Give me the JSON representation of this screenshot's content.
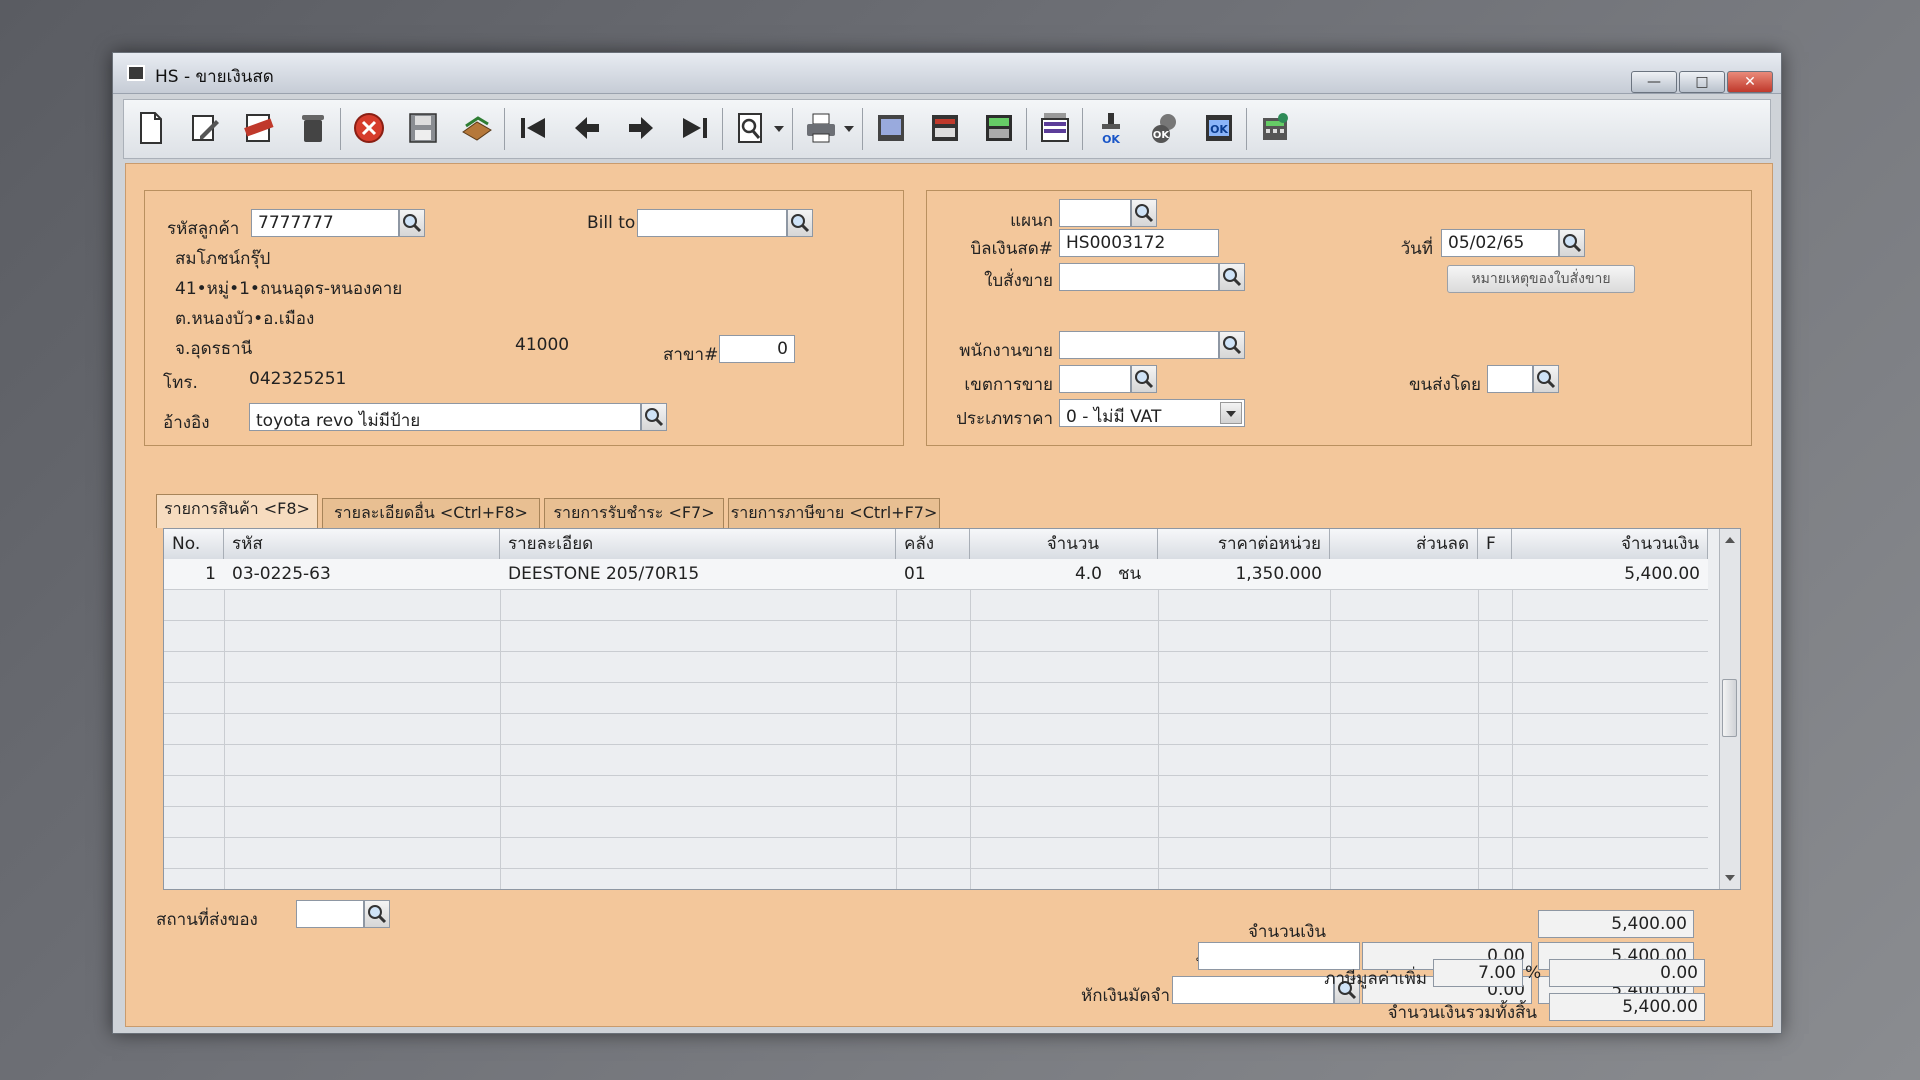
{
  "window": {
    "title": "HS - ขายเงินสด",
    "minimize": "—",
    "maximize": "□",
    "close": "✕"
  },
  "toolbar": {
    "icons": [
      "new-document-icon",
      "edit-icon",
      "void-icon",
      "delete-bin-icon",
      "cancel-icon",
      "save-icon",
      "approve-icon",
      "first-record-icon",
      "previous-record-icon",
      "next-record-icon",
      "last-record-icon",
      "search-preview-icon",
      "print-icon",
      "report-icon",
      "form-icon",
      "calculate-icon",
      "reprint-icon",
      "ok-stamp-icon",
      "check-icon",
      "ok-confirm-icon",
      "calculator-icon"
    ]
  },
  "customer": {
    "code_label": "รหัสลูกค้า",
    "code": "7777777",
    "bill_to_label": "Bill to",
    "bill_to": "",
    "name": "สมโภชน์กรุ๊ป",
    "address1": "41•หมู่•1•ถนนอุดร-หนองคาย",
    "address2": "ต.หนองบัว•อ.เมือง",
    "province": "จ.อุดรธานี",
    "postcode": "41000",
    "branch_label": "สาขา#",
    "branch": "0",
    "phone_label": "โทร.",
    "phone": "042325251",
    "ref_label": "อ้างอิง",
    "ref": "toyota revo ไม่มีป้าย"
  },
  "doc": {
    "dept_label": "แผนก",
    "dept": "",
    "bill_label": "บิลเงินสด#",
    "bill_no": "HS0003172",
    "date_label": "วันที่",
    "date": "05/02/65",
    "so_label": "ใบสั่งขาย",
    "so": "",
    "so_note_button": "หมายเหตุของใบสั่งขาย",
    "salesman_label": "พนักงานขาย",
    "salesman": "",
    "area_label": "เขตการขาย",
    "area": "",
    "ship_by_label": "ขนส่งโดย",
    "ship_by": "",
    "price_type_label": "ประเภทราคา",
    "price_type": "0 - ไม่มี VAT"
  },
  "tabs": [
    "รายการสินค้า <F8>",
    "รายละเอียดอื่น <Ctrl+F8>",
    "รายการรับชำระ <F7>",
    "รายการภาษีขาย <Ctrl+F7>"
  ],
  "grid": {
    "headers": [
      "No.",
      "รหัส",
      "รายละเอียด",
      "คลัง",
      "จำนวน",
      "ราคาต่อหน่วย",
      "ส่วนลด",
      "F",
      "จำนวนเงิน"
    ],
    "rows": [
      {
        "no": "1",
        "code": "03-0225-63",
        "desc": "DEESTONE 205/70R15",
        "wh": "01",
        "qty": "4.0",
        "unit": "ชน",
        "price": "1,350.000",
        "disc": "",
        "f": "",
        "amount": "5,400.00"
      }
    ]
  },
  "footer": {
    "ship_place_label": "สถานที่ส่งของ",
    "ship_place": "",
    "amount_label": "จำนวนเงิน",
    "amount": "5,400.00",
    "discount_label": "หักส่วนลด",
    "discount_text": "",
    "discount_value": "0.00",
    "after_discount": "5,400.00",
    "deposit_label": "หักเงินมัดจำ",
    "deposit_text": "",
    "deposit_value": "0.00",
    "after_deposit": "5,400.00",
    "vat_label": "ภาษีมูลค่าเพิ่ม",
    "vat_rate": "7.00",
    "vat_pct": "%",
    "vat_amount": "0.00",
    "total_label": "จำนวนเงินรวมทั้งสิ้น",
    "total": "5,400.00"
  }
}
